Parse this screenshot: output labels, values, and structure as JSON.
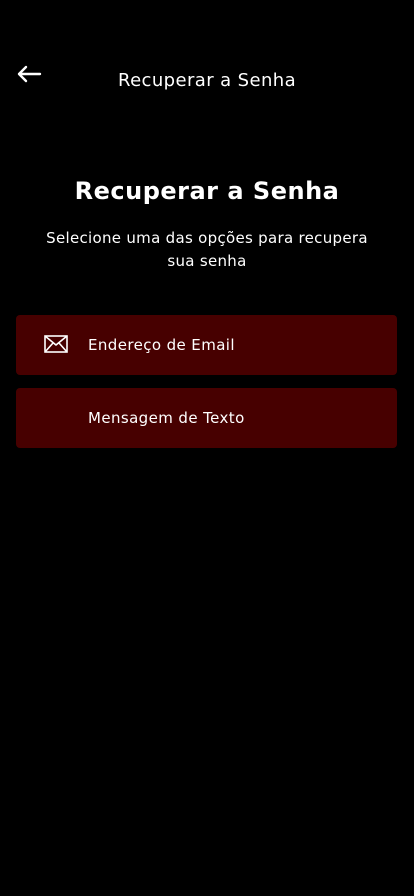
{
  "header": {
    "title": "Recuperar a Senha",
    "back_icon": "arrow-left-icon"
  },
  "main": {
    "title": "Recuperar a Senha",
    "subtitle": "Selecione uma das opções para recupera sua senha"
  },
  "options": [
    {
      "label": "Endereço de Email",
      "icon": "envelope-icon"
    },
    {
      "label": "Mensagem de Texto",
      "icon": ""
    }
  ],
  "colors": {
    "background": "#000000",
    "option_background": "#470000",
    "text": "#ffffff"
  }
}
